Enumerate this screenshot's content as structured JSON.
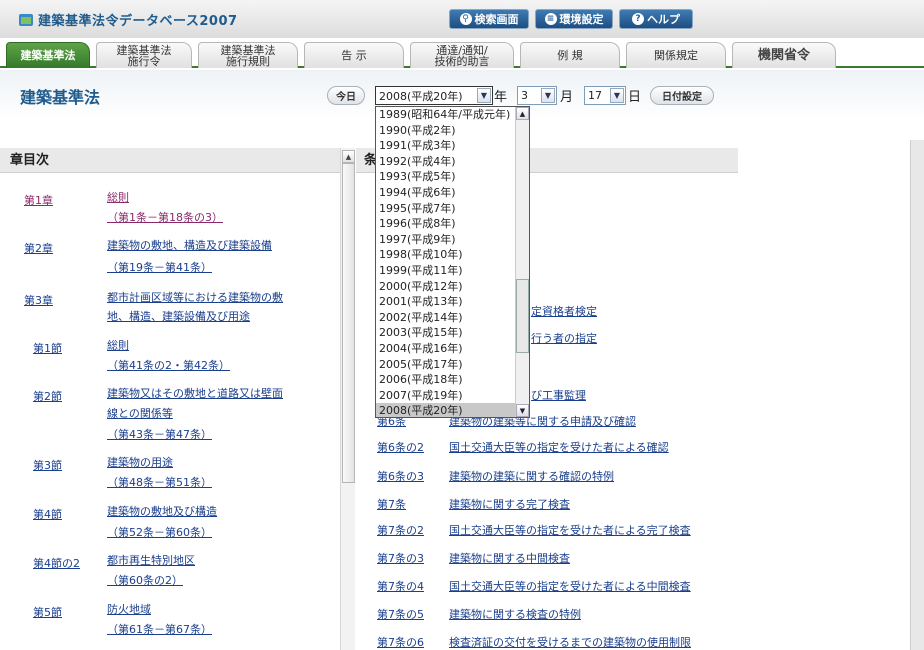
{
  "header": {
    "app_title": "建築基準法令データベース2007",
    "search_btn": "検索画面",
    "env_btn": "環境設定",
    "help_btn": "ヘルプ"
  },
  "tabs": [
    {
      "label": "建築基準法"
    },
    {
      "label": "建築基準法\n施行令"
    },
    {
      "label": "建築基準法\n施行規則"
    },
    {
      "label": "告 示"
    },
    {
      "label": "通達/通知/\n技術的助言"
    },
    {
      "label": "例 規"
    },
    {
      "label": "関係規定"
    },
    {
      "label": "機関省令"
    }
  ],
  "titlebar": {
    "page_title": "建築基準法",
    "today_btn": "今日",
    "year_value": "2008(平成20年)",
    "year_unit": "年",
    "month_value": "3",
    "month_unit": "月",
    "day_value": "17",
    "day_unit": "日",
    "set_date_btn": "日付設定"
  },
  "year_options": [
    "1989(昭和64年/平成元年)",
    "1990(平成2年)",
    "1991(平成3年)",
    "1992(平成4年)",
    "1993(平成5年)",
    "1994(平成6年)",
    "1995(平成7年)",
    "1996(平成8年)",
    "1997(平成9年)",
    "1998(平成10年)",
    "1999(平成11年)",
    "2000(平成12年)",
    "2001(平成13年)",
    "2002(平成14年)",
    "2003(平成15年)",
    "2004(平成16年)",
    "2005(平成17年)",
    "2006(平成18年)",
    "2007(平成19年)",
    "2008(平成20年)"
  ],
  "left_panel": {
    "heading": "章目次",
    "items": [
      {
        "num": "第1章",
        "title": "総則",
        "range": "（第1条－第18条の3）"
      },
      {
        "num": "第2章",
        "title": "建築物の敷地、構造及び建築設備",
        "range": "（第19条－第41条）"
      },
      {
        "num": "第3章",
        "title": "都市計画区域等における建築物の敷",
        "title2": "地、構造、建築設備及び用途"
      },
      {
        "num": "第1節",
        "title": "総則",
        "range": "（第41条の2・第42条）"
      },
      {
        "num": "第2節",
        "title": "建築物又はその敷地と道路又は壁面",
        "title2": "線との関係等",
        "range": "（第43条－第47条）"
      },
      {
        "num": "第3節",
        "title": "建築物の用途",
        "range": "（第48条－第51条）"
      },
      {
        "num": "第4節",
        "title": "建築物の敷地及び構造",
        "range": "（第52条－第60条）"
      },
      {
        "num": "第4節の2",
        "title": "都市再生特別地区",
        "range": "（第60条の2）"
      },
      {
        "num": "第5節",
        "title": "防火地域",
        "range": "（第61条－第67条）"
      }
    ]
  },
  "right_panel": {
    "heading": "条",
    "partials": [
      "定資格者検定",
      "行う者の指定",
      "び工事監理",
      "第6条",
      "建築物の建築等に関する申請及び確認"
    ],
    "items": [
      {
        "num": "第6条の2",
        "title": "国土交通大臣等の指定を受けた者による確認"
      },
      {
        "num": "第6条の3",
        "title": "建築物の建築に関する確認の特例"
      },
      {
        "num": "第7条",
        "title": "建築物に関する完了検査"
      },
      {
        "num": "第7条の2",
        "title": "国土交通大臣等の指定を受けた者による完了検査"
      },
      {
        "num": "第7条の3",
        "title": "建築物に関する中間検査"
      },
      {
        "num": "第7条の4",
        "title": "国土交通大臣等の指定を受けた者による中間検査"
      },
      {
        "num": "第7条の5",
        "title": "建築物に関する検査の特例"
      },
      {
        "num": "第7条の6",
        "title": "検査済証の交付を受けるまでの建築物の使用制限"
      }
    ]
  }
}
